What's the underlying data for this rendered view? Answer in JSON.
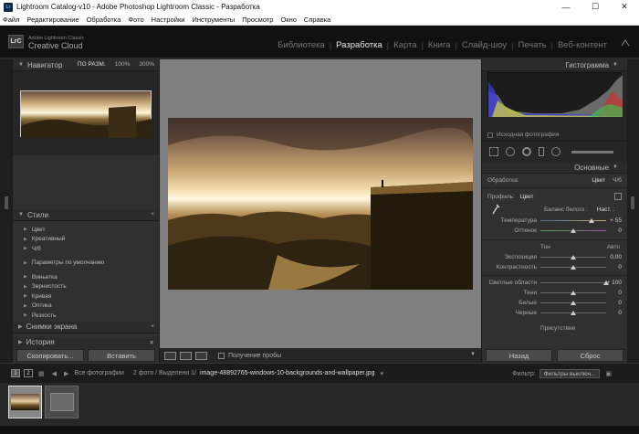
{
  "window": {
    "title": "Lightroom Catalog-v10 - Adobe Photoshop Lightroom Classic - Разработка",
    "app_icon": "Lr",
    "minimize_icon": "—",
    "maximize_icon": "☐",
    "close_icon": "✕"
  },
  "menu": [
    "Файл",
    "Редактирование",
    "Обработка",
    "Фото",
    "Настройки",
    "Инструменты",
    "Просмотр",
    "Окно",
    "Справка"
  ],
  "identity": {
    "logo": "LrC",
    "brand_line1": "Adobe Lightroom Classic",
    "brand_line2": "Creative Cloud"
  },
  "modules": [
    "Библиотека",
    "Разработка",
    "Карта",
    "Книга",
    "Слайд-шоу",
    "Печать",
    "Веб-контент"
  ],
  "active_module": "Разработка",
  "left_panel": {
    "navigator_label": "Навигатор",
    "zoom_options": [
      "ПО РАЗМ.",
      "100%",
      "300%"
    ],
    "styles_label": "Стили",
    "styles_items": [
      "Цвет",
      "Креативный",
      "Ч/б"
    ],
    "defaults_item": "Параметры по умолчанию",
    "styles_items_2": [
      "Виньетка",
      "Зернистость",
      "Кривая",
      "Оптика",
      "Резкость"
    ],
    "snapshots_label": "Снимки экрана",
    "history_label": "История",
    "copy_button": "Скопировать...",
    "paste_button": "Вставить"
  },
  "center": {
    "soft_proof_label": "Получение пробы"
  },
  "right_panel": {
    "histogram_label": "Гистограмма",
    "original_photo_label": "Исходная фотография",
    "basic_label": "Основные",
    "treatment_label": "Обработка:",
    "treatment_color": "Цвет",
    "treatment_bw": "Ч/б",
    "profile_label": "Профиль:",
    "profile_value": "Цвет",
    "wb_label": "Баланс белого :",
    "wb_value": "Наст. :",
    "temp_label": "Температура",
    "temp_value": "+ 55",
    "tint_label": "Оттенок",
    "tint_value": "0",
    "tone_label": "Тон",
    "auto_label": "Авто",
    "exposure_label": "Экспозиция",
    "exposure_value": "0,00",
    "contrast_label": "Контрастность",
    "contrast_value": "0",
    "highlights_label": "Светлые области",
    "highlights_value": "+ 100",
    "shadows_label": "Тени",
    "shadows_value": "0",
    "whites_label": "Белые",
    "whites_value": "0",
    "blacks_label": "Черные",
    "blacks_value": "0",
    "presence_label": "Присутствие",
    "reset_prev_button": "Назад",
    "reset_button": "Сброс"
  },
  "filmstrip": {
    "screen1": "1",
    "screen2": "2",
    "source": "Все фотографии",
    "counts": "2 фото / Выделено 1/",
    "filename": "image-48892765-windows-10-backgrounds-and-wallpaper.jpg",
    "filter_label": "Фильтр:",
    "filter_value": "Фильтры выключ..."
  }
}
